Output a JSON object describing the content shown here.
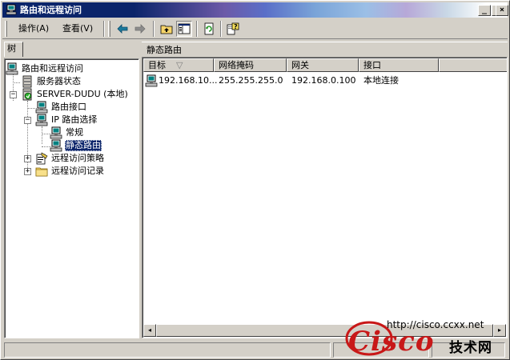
{
  "window": {
    "title": "路由和远程访问",
    "controls": {
      "minimize": "_",
      "maximize": "□",
      "close": "×"
    }
  },
  "menu": {
    "items": [
      {
        "label": "操作(A)"
      },
      {
        "label": "查看(V)"
      }
    ]
  },
  "toolbar": {
    "buttons": [
      "back-arrow-icon",
      "forward-arrow-icon",
      "up-folder-icon",
      "show-tree-icon",
      "refresh-icon",
      "help-icon"
    ]
  },
  "tree": {
    "tab_label": "树",
    "nodes": [
      {
        "label": "路由和远程访问",
        "icon": "network-icon"
      },
      {
        "label": "服务器状态",
        "icon": "server-icon"
      },
      {
        "label": "SERVER-DUDU (本地)",
        "icon": "server-green-icon",
        "expander": "−"
      },
      {
        "label": "路由接口",
        "icon": "network-icon"
      },
      {
        "label": "IP 路由选择",
        "icon": "network-icon",
        "expander": "−"
      },
      {
        "label": "常规",
        "icon": "network-icon"
      },
      {
        "label": "静态路由",
        "icon": "network-icon",
        "selected": true
      },
      {
        "label": "远程访问策略",
        "icon": "policy-icon",
        "expander": "+"
      },
      {
        "label": "远程访问记录",
        "icon": "folder-icon",
        "expander": "+"
      }
    ]
  },
  "list": {
    "header_title": "静态路由",
    "columns": [
      {
        "label": "目标",
        "sort": "▽"
      },
      {
        "label": "网络掩码"
      },
      {
        "label": "网关"
      },
      {
        "label": "接口"
      }
    ],
    "rows": [
      {
        "cells": [
          "192.168.10...",
          "255.255.255.0",
          "192.168.0.100",
          "本地连接"
        ]
      }
    ],
    "scroll": {
      "left": "◂",
      "right": "▸"
    }
  },
  "watermark": {
    "url": "http://cisco.ccxx.net",
    "logo": "Cisco",
    "cn": "技术网"
  },
  "colors": {
    "selection": "#0a246a",
    "face": "#d4d0c8",
    "logo_red": "#c81818"
  }
}
